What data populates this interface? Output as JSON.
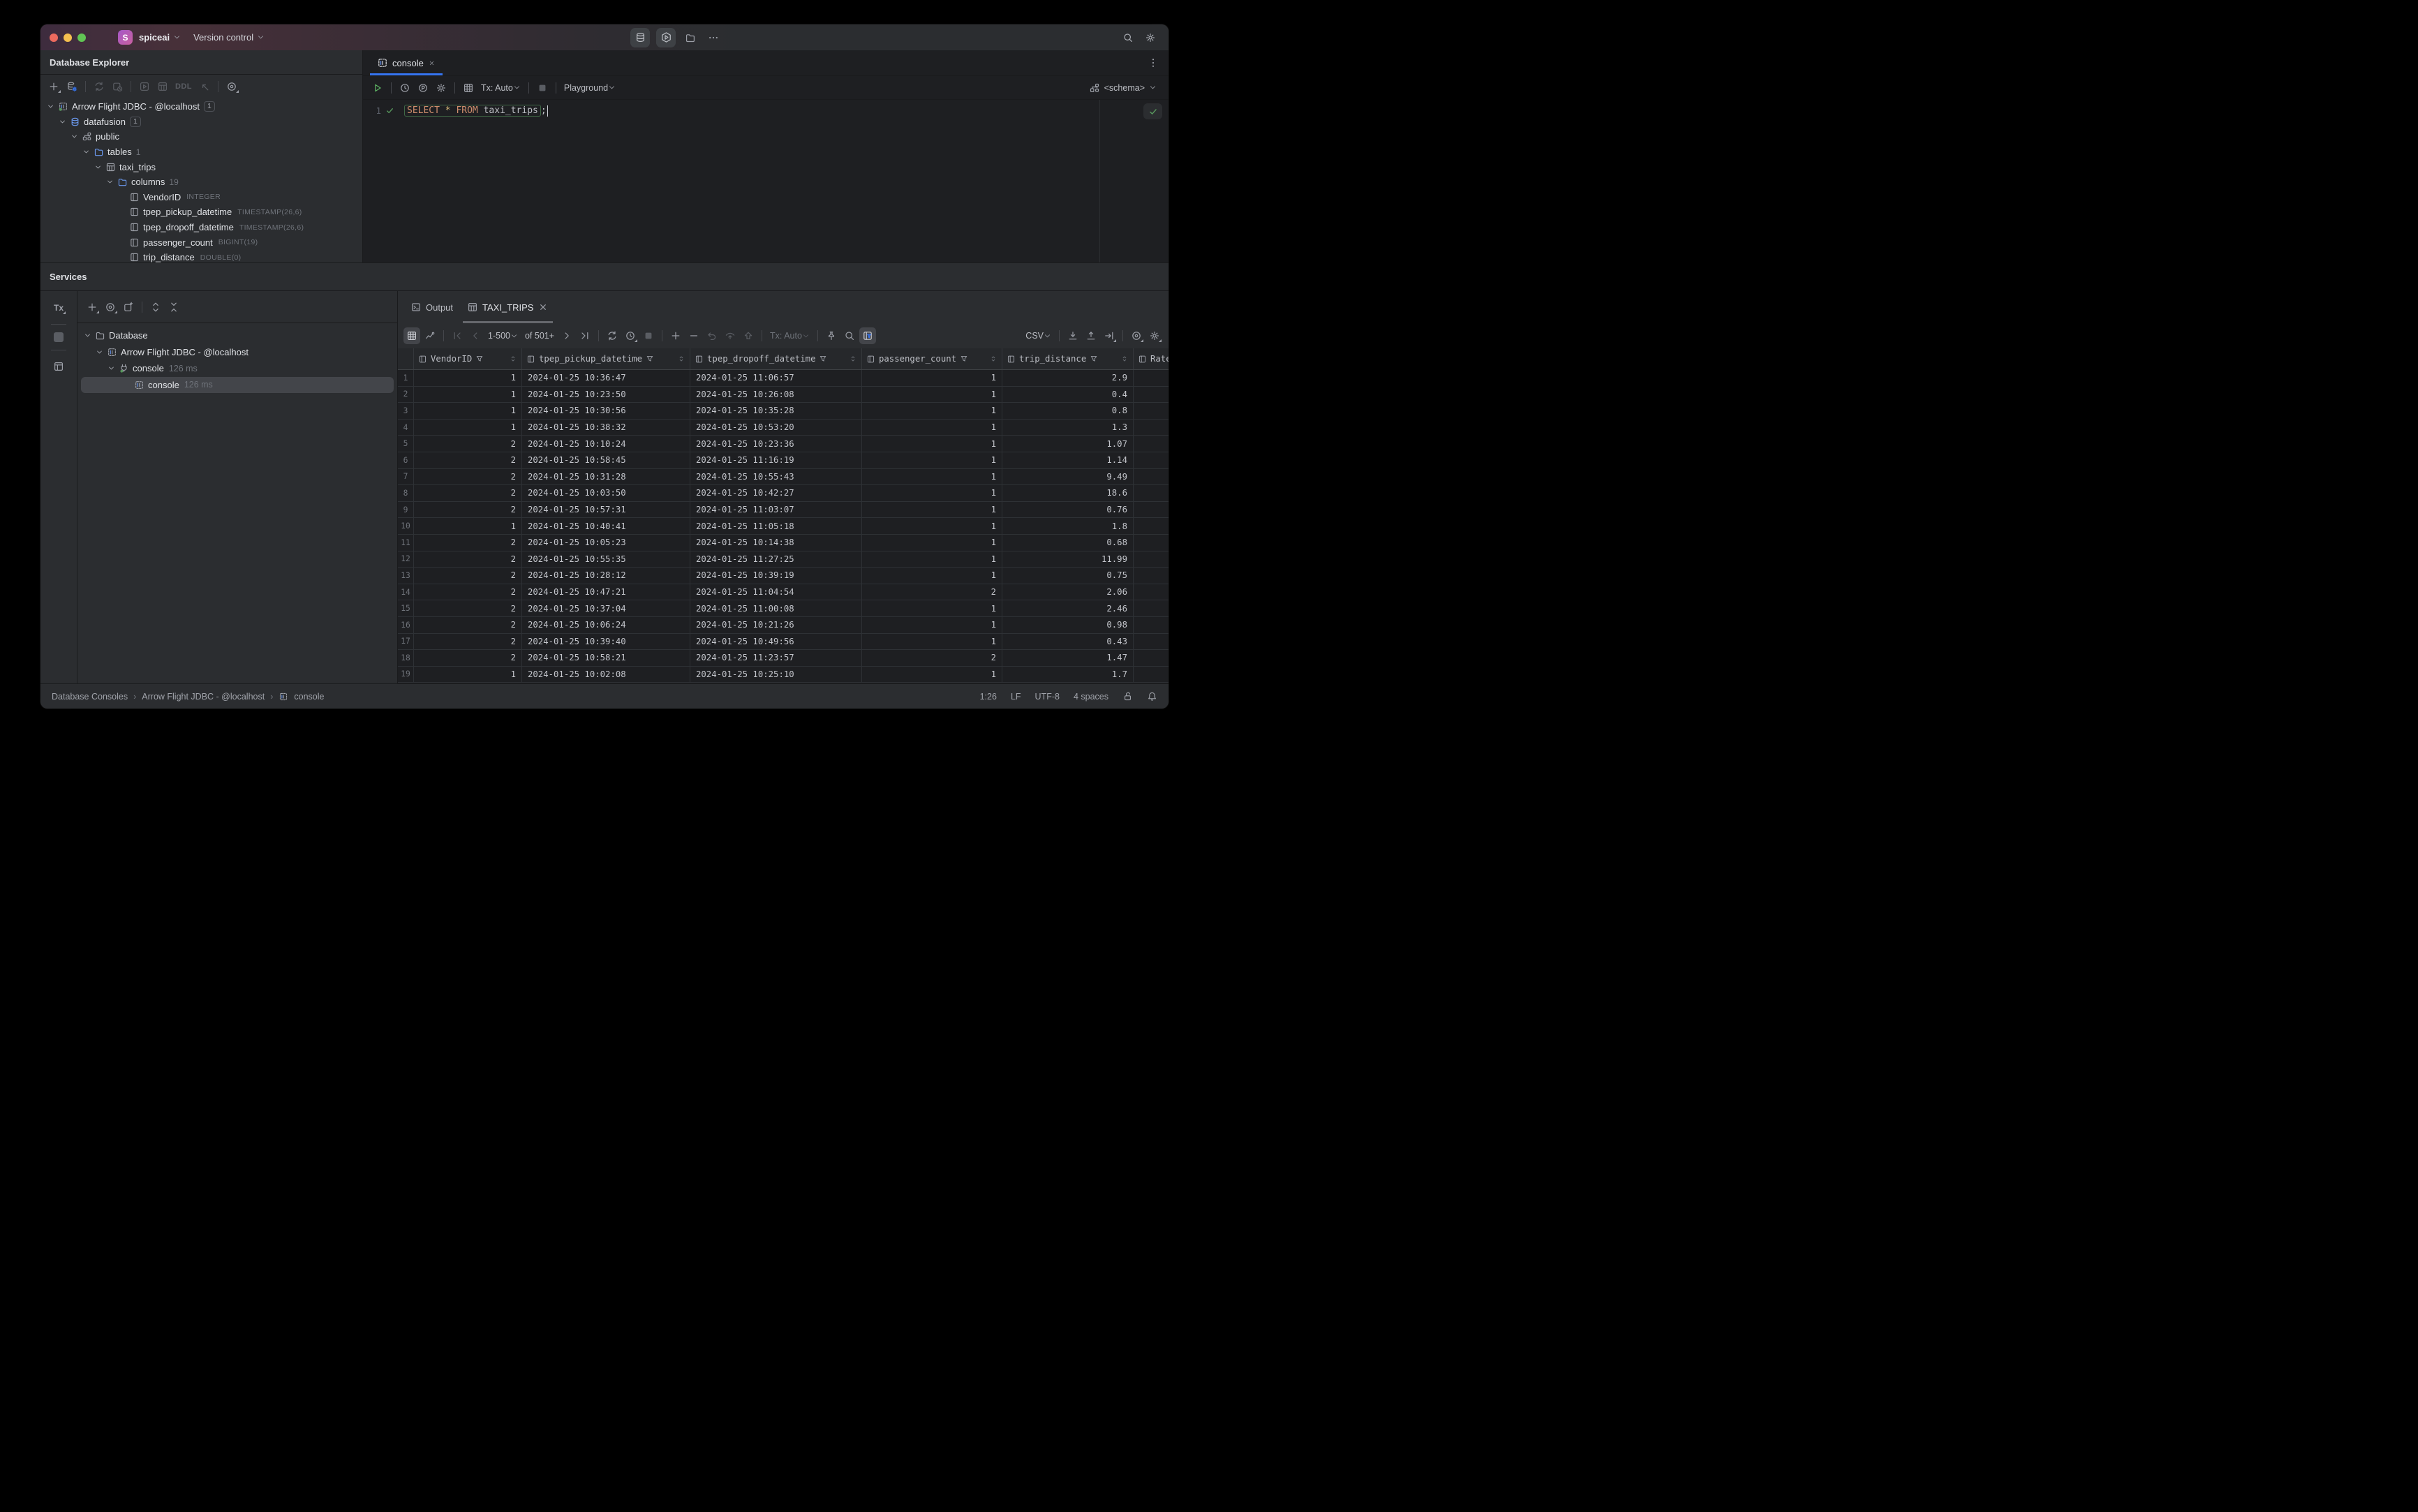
{
  "colors": {
    "accent": "#3574f0",
    "green": "#57965c",
    "keyword_orange": "#cf8e6d",
    "selection": "#43454a"
  },
  "titlebar": {
    "project_initial": "S",
    "project": "spiceai",
    "menu": "Version control",
    "center_buttons": [
      {
        "icon": "db",
        "boxed": true,
        "name": "database-toolwindow-button"
      },
      {
        "icon": "hex-play",
        "boxed": true,
        "name": "services-toolwindow-button"
      },
      {
        "icon": "folder",
        "name": "project-toolwindow-button"
      },
      {
        "icon": "more",
        "name": "more-toolwindows-button"
      }
    ]
  },
  "database_explorer": {
    "title": "Database Explorer",
    "toolbar": [
      {
        "icon": "plus",
        "corner": true,
        "name": "new-datasource-button"
      },
      {
        "icon": "db-gear",
        "name": "datasource-properties-button"
      },
      {
        "sep": true
      },
      {
        "icon": "refresh",
        "dim": true,
        "name": "refresh-button"
      },
      {
        "icon": "square-clock",
        "dim": true,
        "name": "deactivate-button"
      },
      {
        "sep": true
      },
      {
        "icon": "play-square",
        "dim": true,
        "name": "new-query-console-button"
      },
      {
        "icon": "table",
        "dim": true,
        "name": "open-table-button"
      },
      {
        "text": "DDL",
        "dim": true,
        "name": "ddl-button"
      },
      {
        "icon": "arrow-into-corner",
        "dim": true,
        "name": "jump-to-ddl-button"
      },
      {
        "sep": true
      },
      {
        "icon": "target",
        "corner": true,
        "name": "select-opened-element-button"
      }
    ],
    "tree": [
      {
        "label": "Arrow Flight JDBC - @localhost",
        "icon": "arrow-flight-online",
        "chevron": true,
        "level": 0,
        "badge": "1",
        "badge_style": "boxed"
      },
      {
        "label": "datafusion",
        "icon": "db",
        "icon_blue": true,
        "chevron": true,
        "level": 1,
        "badge": "1",
        "badge_style": "boxed"
      },
      {
        "label": "public",
        "icon": "schema",
        "chevron": true,
        "level": 2
      },
      {
        "label": "tables",
        "icon": "folder",
        "icon_blue": true,
        "chevron": true,
        "level": 3,
        "badge": "1",
        "badge_style": "plain"
      },
      {
        "label": "taxi_trips",
        "icon": "table",
        "chevron": true,
        "level": 4
      },
      {
        "label": "columns",
        "icon": "folder",
        "icon_blue": true,
        "chevron": true,
        "level": 5,
        "badge": "19",
        "badge_style": "plain"
      },
      {
        "label": "VendorID",
        "icon": "column",
        "level": 6,
        "type": "INTEGER"
      },
      {
        "label": "tpep_pickup_datetime",
        "icon": "column",
        "level": 6,
        "type": "TIMESTAMP(26,6)"
      },
      {
        "label": "tpep_dropoff_datetime",
        "icon": "column",
        "level": 6,
        "type": "TIMESTAMP(26,6)"
      },
      {
        "label": "passenger_count",
        "icon": "column",
        "level": 6,
        "type": "BIGINT(19)"
      },
      {
        "label": "trip_distance",
        "icon": "column",
        "level": 6,
        "type": "DOUBLE(0)"
      }
    ]
  },
  "editor": {
    "tab_label": "console",
    "line_number": "1",
    "schema_label": "<schema>",
    "toolbar": [
      {
        "icon": "play",
        "green": true,
        "name": "execute-button"
      },
      {
        "sep": true
      },
      {
        "icon": "clock",
        "name": "query-history-button"
      },
      {
        "icon": "p-circle",
        "name": "parameters-button"
      },
      {
        "icon": "gear",
        "name": "console-settings-button"
      },
      {
        "sep": true
      },
      {
        "icon": "grid",
        "name": "in-editor-results-button"
      },
      {
        "label": "Tx: Auto",
        "chev": true,
        "name": "tx-mode-select"
      },
      {
        "sep": true
      },
      {
        "icon": "stop",
        "dim": true,
        "name": "stop-button"
      },
      {
        "sep": true
      },
      {
        "label": "Playground",
        "chev": true,
        "name": "playground-mode-select"
      }
    ],
    "sql_tokens": [
      {
        "text": "SELECT",
        "type": "keyword",
        "in_box": true
      },
      {
        "text": " ",
        "type": "plain",
        "in_box": true
      },
      {
        "text": "*",
        "type": "star",
        "in_box": true
      },
      {
        "text": " ",
        "type": "plain",
        "in_box": true
      },
      {
        "text": "FROM",
        "type": "keyword",
        "in_box": true
      },
      {
        "text": " ",
        "type": "plain",
        "in_box": true
      },
      {
        "text": "taxi_trips",
        "type": "plain",
        "in_box": true
      },
      {
        "text": ";",
        "type": "plain",
        "in_box": false
      }
    ]
  },
  "services": {
    "title": "Services",
    "strip_tx": "Tx",
    "toolbar": [
      {
        "icon": "plus",
        "corner": true,
        "name": "add-service-button"
      },
      {
        "icon": "target",
        "corner": true,
        "name": "select-in-services-button"
      },
      {
        "icon": "open-new",
        "name": "open-in-new-tab-button"
      },
      {
        "sep": true
      },
      {
        "icon": "expand-all",
        "name": "expand-all-button"
      },
      {
        "icon": "collapse-all",
        "name": "collapse-all-button"
      }
    ],
    "tree": [
      {
        "label": "Database",
        "icon": "folder",
        "chevron": true,
        "level": 0
      },
      {
        "label": "Arrow Flight JDBC - @localhost",
        "icon": "arrow-flight",
        "chevron": true,
        "level": 1
      },
      {
        "label": "console",
        "icon": "plug-online",
        "chevron": true,
        "level": 2,
        "meta": "126 ms"
      },
      {
        "label": "console",
        "icon": "arrow-flight",
        "level": 3,
        "meta": "126 ms",
        "selected": true
      }
    ]
  },
  "results": {
    "tabs": [
      {
        "label": "Output",
        "icon": "terminal",
        "active": false
      },
      {
        "label": "TAXI_TRIPS",
        "icon": "table",
        "active": true,
        "closable": true
      }
    ],
    "toolbar_left": [
      {
        "icon": "grid",
        "active": true,
        "name": "grid-view-button"
      },
      {
        "icon": "chart",
        "name": "chart-view-button"
      },
      {
        "sep": true
      },
      {
        "icon": "page-first",
        "dim": true,
        "name": "first-page-button"
      },
      {
        "icon": "page-prev",
        "dim": true,
        "name": "previous-page-button"
      },
      {
        "label": "1-500",
        "chev": true,
        "name": "page-range-select"
      },
      {
        "label": "of 501+",
        "name": "total-rows-label"
      },
      {
        "icon": "page-next",
        "name": "next-page-button"
      },
      {
        "icon": "page-last",
        "name": "last-page-button"
      },
      {
        "sep": true
      },
      {
        "icon": "refresh",
        "name": "reload-page-button"
      },
      {
        "icon": "clock",
        "corner": true,
        "name": "auto-refresh-button"
      },
      {
        "icon": "stop",
        "dim": true,
        "name": "stop-query-button"
      },
      {
        "sep": true
      },
      {
        "icon": "plus",
        "name": "add-row-button"
      },
      {
        "icon": "minus",
        "name": "delete-row-button"
      },
      {
        "icon": "undo",
        "dim": true,
        "name": "revert-button"
      },
      {
        "icon": "commit",
        "dim": true,
        "name": "preview-changes-button"
      },
      {
        "icon": "arrow-up-big",
        "dim": true,
        "name": "submit-button"
      },
      {
        "sep": true
      },
      {
        "label": "Tx: Auto",
        "chev": true,
        "dim": true,
        "name": "results-tx-mode-select"
      },
      {
        "sep": true
      },
      {
        "icon": "pin",
        "name": "pin-tab-button"
      },
      {
        "icon": "search",
        "name": "find-button"
      },
      {
        "icon": "filter-panel",
        "active": true,
        "name": "sort-filter-panel-button"
      }
    ],
    "toolbar_right": [
      {
        "label": "CSV",
        "chev": true,
        "name": "export-format-select"
      },
      {
        "sep": true
      },
      {
        "icon": "download",
        "name": "import-button"
      },
      {
        "icon": "upload",
        "name": "export-data-button"
      },
      {
        "icon": "export-corner",
        "corner": true,
        "name": "dump-data-button"
      },
      {
        "sep": true
      },
      {
        "icon": "target",
        "corner": true,
        "name": "view-options-button"
      },
      {
        "icon": "gear",
        "corner": true,
        "name": "grid-settings-button"
      }
    ],
    "columns": [
      {
        "name": "VendorID",
        "align": "right"
      },
      {
        "name": "tpep_pickup_datetime",
        "align": "left"
      },
      {
        "name": "tpep_dropoff_datetime",
        "align": "left"
      },
      {
        "name": "passenger_count",
        "align": "right"
      },
      {
        "name": "trip_distance",
        "align": "right"
      },
      {
        "name": "Rate",
        "align": "left",
        "clipped": true
      }
    ],
    "rows": [
      [
        "1",
        "2024-01-25 10:36:47",
        "2024-01-25 11:06:57",
        "1",
        "2.9"
      ],
      [
        "1",
        "2024-01-25 10:23:50",
        "2024-01-25 10:26:08",
        "1",
        "0.4"
      ],
      [
        "1",
        "2024-01-25 10:30:56",
        "2024-01-25 10:35:28",
        "1",
        "0.8"
      ],
      [
        "1",
        "2024-01-25 10:38:32",
        "2024-01-25 10:53:20",
        "1",
        "1.3"
      ],
      [
        "2",
        "2024-01-25 10:10:24",
        "2024-01-25 10:23:36",
        "1",
        "1.07"
      ],
      [
        "2",
        "2024-01-25 10:58:45",
        "2024-01-25 11:16:19",
        "1",
        "1.14"
      ],
      [
        "2",
        "2024-01-25 10:31:28",
        "2024-01-25 10:55:43",
        "1",
        "9.49"
      ],
      [
        "2",
        "2024-01-25 10:03:50",
        "2024-01-25 10:42:27",
        "1",
        "18.6"
      ],
      [
        "2",
        "2024-01-25 10:57:31",
        "2024-01-25 11:03:07",
        "1",
        "0.76"
      ],
      [
        "1",
        "2024-01-25 10:40:41",
        "2024-01-25 11:05:18",
        "1",
        "1.8"
      ],
      [
        "2",
        "2024-01-25 10:05:23",
        "2024-01-25 10:14:38",
        "1",
        "0.68"
      ],
      [
        "2",
        "2024-01-25 10:55:35",
        "2024-01-25 11:27:25",
        "1",
        "11.99"
      ],
      [
        "2",
        "2024-01-25 10:28:12",
        "2024-01-25 10:39:19",
        "1",
        "0.75"
      ],
      [
        "2",
        "2024-01-25 10:47:21",
        "2024-01-25 11:04:54",
        "2",
        "2.06"
      ],
      [
        "2",
        "2024-01-25 10:37:04",
        "2024-01-25 11:00:08",
        "1",
        "2.46"
      ],
      [
        "2",
        "2024-01-25 10:06:24",
        "2024-01-25 10:21:26",
        "1",
        "0.98"
      ],
      [
        "2",
        "2024-01-25 10:39:40",
        "2024-01-25 10:49:56",
        "1",
        "0.43"
      ],
      [
        "2",
        "2024-01-25 10:58:21",
        "2024-01-25 11:23:57",
        "2",
        "1.47"
      ],
      [
        "1",
        "2024-01-25 10:02:08",
        "2024-01-25 10:25:10",
        "1",
        "1.7"
      ]
    ]
  },
  "statusbar": {
    "breadcrumbs": [
      "Database Consoles",
      "Arrow Flight JDBC - @localhost",
      "console"
    ],
    "cursor": "1:26",
    "line_ending": "LF",
    "encoding": "UTF-8",
    "indent": "4 spaces"
  }
}
